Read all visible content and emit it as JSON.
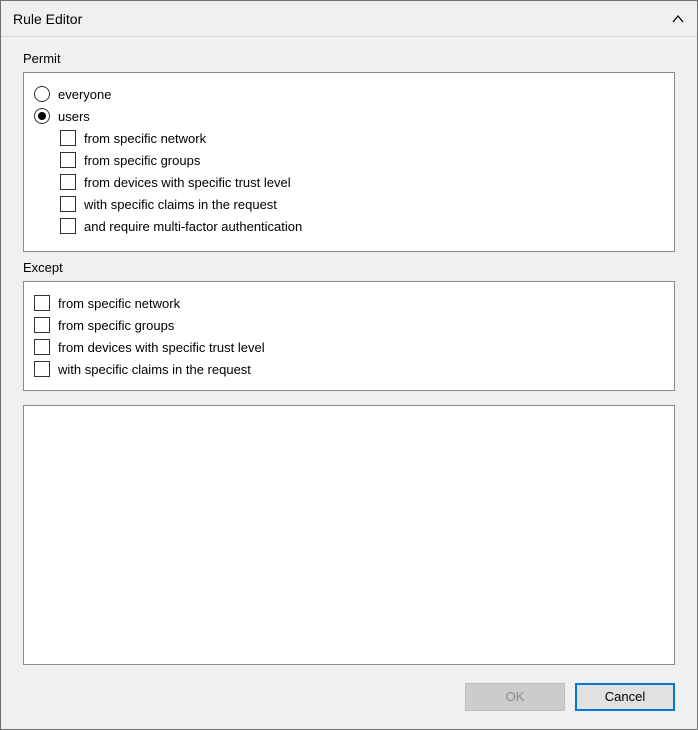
{
  "title": "Rule Editor",
  "permit": {
    "label": "Permit",
    "everyone": {
      "label": "everyone",
      "checked": false
    },
    "users": {
      "label": "users",
      "checked": true,
      "sub": [
        {
          "label": "from specific network",
          "checked": false
        },
        {
          "label": "from specific groups",
          "checked": false
        },
        {
          "label": "from devices with specific trust level",
          "checked": false
        },
        {
          "label": "with specific claims in the request",
          "checked": false
        },
        {
          "label": "and require multi-factor authentication",
          "checked": false
        }
      ]
    }
  },
  "except": {
    "label": "Except",
    "items": [
      {
        "label": "from specific network",
        "checked": false
      },
      {
        "label": "from specific groups",
        "checked": false
      },
      {
        "label": "from devices with specific trust level",
        "checked": false
      },
      {
        "label": "with specific claims in the request",
        "checked": false
      }
    ]
  },
  "buttons": {
    "ok": "OK",
    "cancel": "Cancel"
  }
}
